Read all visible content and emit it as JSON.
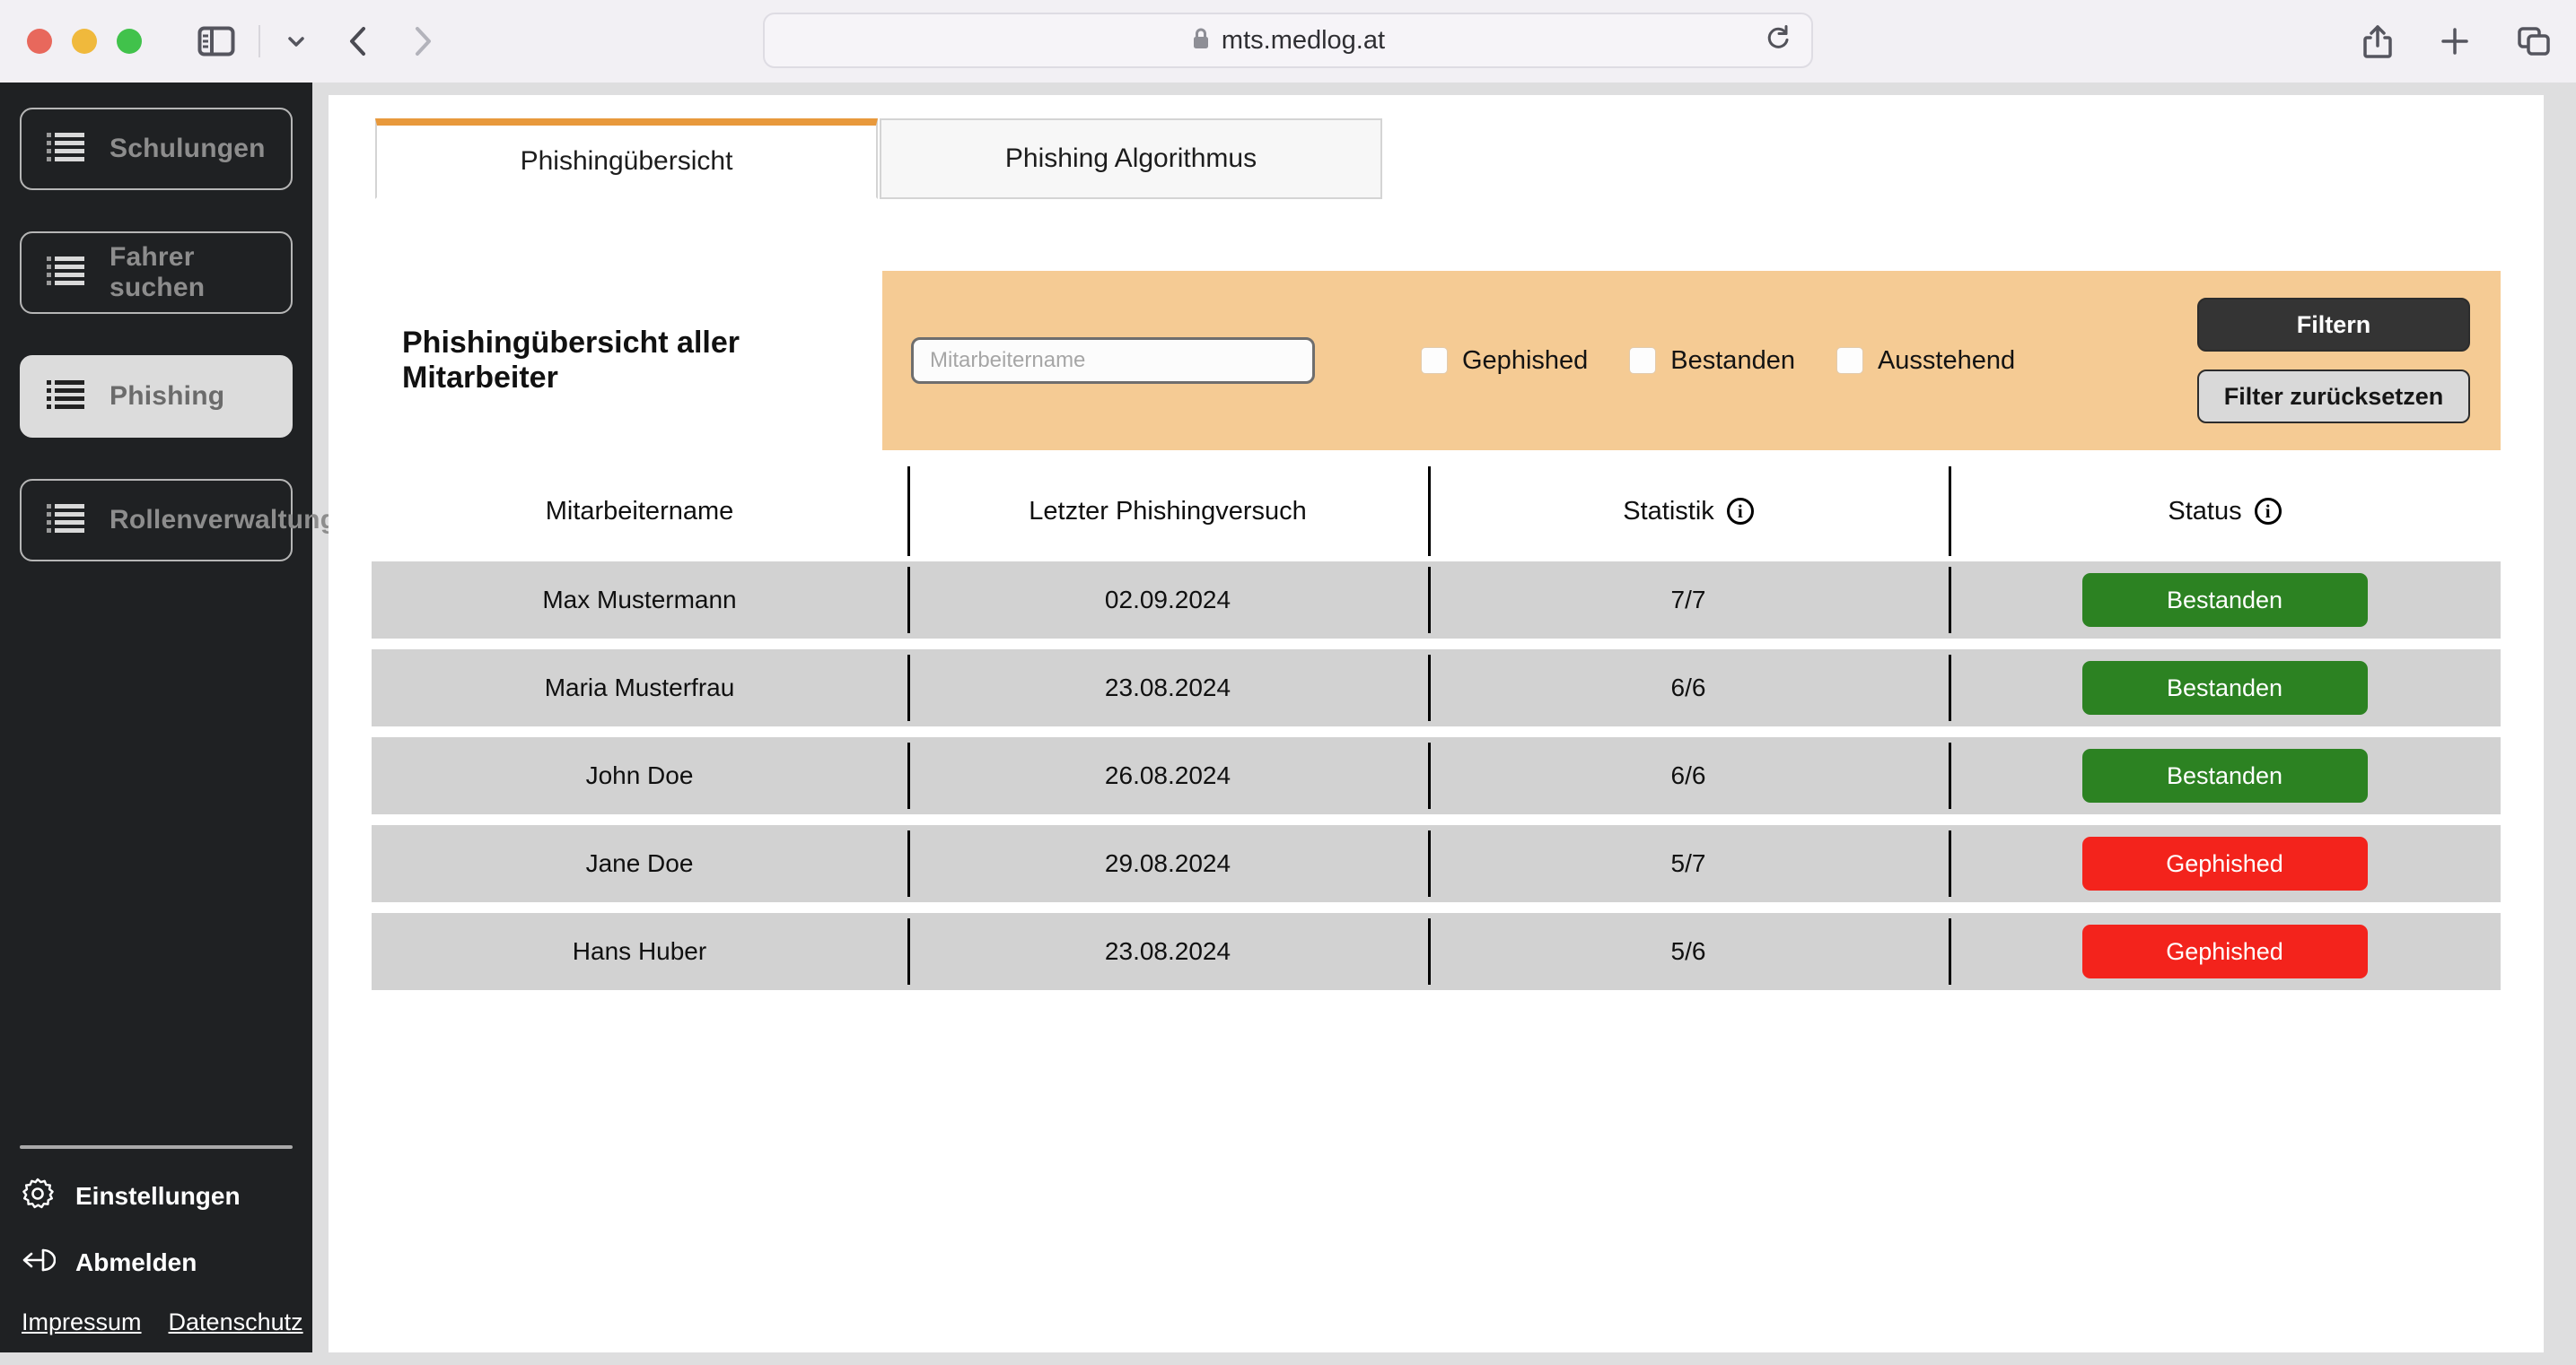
{
  "browser": {
    "url": "mts.medlog.at",
    "lock_icon": "lock-icon",
    "reload_icon": "reload-icon",
    "back_icon": "chevron-left-icon",
    "forward_icon": "chevron-right-icon",
    "sidebar_icon": "sidebar-toggle-icon",
    "chevron_icon": "chevron-down-icon",
    "share_icon": "share-icon",
    "newtab_icon": "plus-icon",
    "tabs_icon": "tab-overview-icon"
  },
  "sidebar": {
    "items": [
      {
        "label": "Schulungen",
        "icon": "list-icon",
        "active": false
      },
      {
        "label": "Fahrer suchen",
        "icon": "list-icon",
        "active": false
      },
      {
        "label": "Phishing",
        "icon": "list-icon",
        "active": true
      },
      {
        "label": "Rollenverwaltung",
        "icon": "list-icon",
        "active": false
      }
    ],
    "settings": {
      "label": "Einstellungen",
      "icon": "gear-icon"
    },
    "logout": {
      "label": "Abmelden",
      "icon": "logout-icon"
    },
    "legal": [
      {
        "label": "Impressum"
      },
      {
        "label": "Datenschutz"
      }
    ]
  },
  "tabs": [
    {
      "label": "Phishingübersicht",
      "active": true
    },
    {
      "label": "Phishing Algorithmus",
      "active": false
    }
  ],
  "page": {
    "title": "Phishingübersicht aller Mitarbeiter"
  },
  "filter": {
    "search_placeholder": "Mitarbeitername",
    "search_value": "",
    "checkboxes": [
      {
        "label": "Gephished",
        "checked": false
      },
      {
        "label": "Bestanden",
        "checked": false
      },
      {
        "label": "Ausstehend",
        "checked": false
      }
    ],
    "apply_label": "Filtern",
    "reset_label": "Filter zurücksetzen",
    "panel_color": "#f5cb94"
  },
  "table": {
    "columns": [
      {
        "label": "Mitarbeitername",
        "info": false
      },
      {
        "label": "Letzter Phishingversuch",
        "info": false
      },
      {
        "label": "Statistik",
        "info": true
      },
      {
        "label": "Status",
        "info": true
      }
    ],
    "info_glyph": "i",
    "rows": [
      {
        "name": "Max Mustermann",
        "date": "02.09.2024",
        "stat": "7/7",
        "status": "Bestanden",
        "status_type": "pass"
      },
      {
        "name": "Maria Musterfrau",
        "date": "23.08.2024",
        "stat": "6/6",
        "status": "Bestanden",
        "status_type": "pass"
      },
      {
        "name": "John Doe",
        "date": "26.08.2024",
        "stat": "6/6",
        "status": "Bestanden",
        "status_type": "pass"
      },
      {
        "name": "Jane Doe",
        "date": "29.08.2024",
        "stat": "5/7",
        "status": "Gephished",
        "status_type": "fail"
      },
      {
        "name": "Hans Huber",
        "date": "23.08.2024",
        "stat": "5/6",
        "status": "Gephished",
        "status_type": "fail"
      }
    ]
  },
  "colors": {
    "accent_orange": "#e8993c",
    "status_pass": "#2c8222",
    "status_fail": "#f3231c",
    "sidebar_bg": "#1f2123",
    "row_bg": "#d2d2d2"
  }
}
